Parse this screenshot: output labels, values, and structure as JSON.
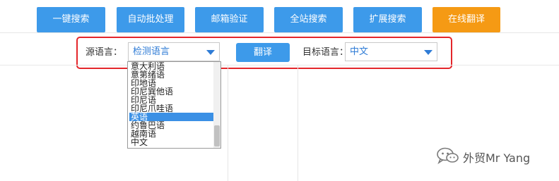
{
  "tabs": [
    {
      "label": "一键搜索",
      "color": "#3d9aea"
    },
    {
      "label": "自动批处理",
      "color": "#3d9aea"
    },
    {
      "label": "邮箱验证",
      "color": "#3d9aea"
    },
    {
      "label": "全站搜索",
      "color": "#3d9aea"
    },
    {
      "label": "扩展搜索",
      "color": "#3d9aea"
    },
    {
      "label": "在线翻译",
      "color": "#f59a14"
    }
  ],
  "translator": {
    "source_label": "源语言：",
    "source_selected": "检测语言",
    "translate_button": "翻译",
    "target_label": "目标语言：",
    "target_selected": "中文"
  },
  "language_list": {
    "items": [
      "意大利语",
      "意第绪语",
      "印地语",
      "印尼巽他语",
      "印尼语",
      "印尼爪哇语",
      "英语",
      "约鲁巴语",
      "越南语",
      "中文"
    ],
    "selected": "英语"
  },
  "watermark": {
    "text": "外贸Mr Yang",
    "icon": "wechat-logo-icon"
  },
  "colors": {
    "accent_blue": "#3d9aea",
    "active_tab": "#f59a14",
    "highlight": "#e4262b",
    "select_text": "#2f7cd6"
  }
}
